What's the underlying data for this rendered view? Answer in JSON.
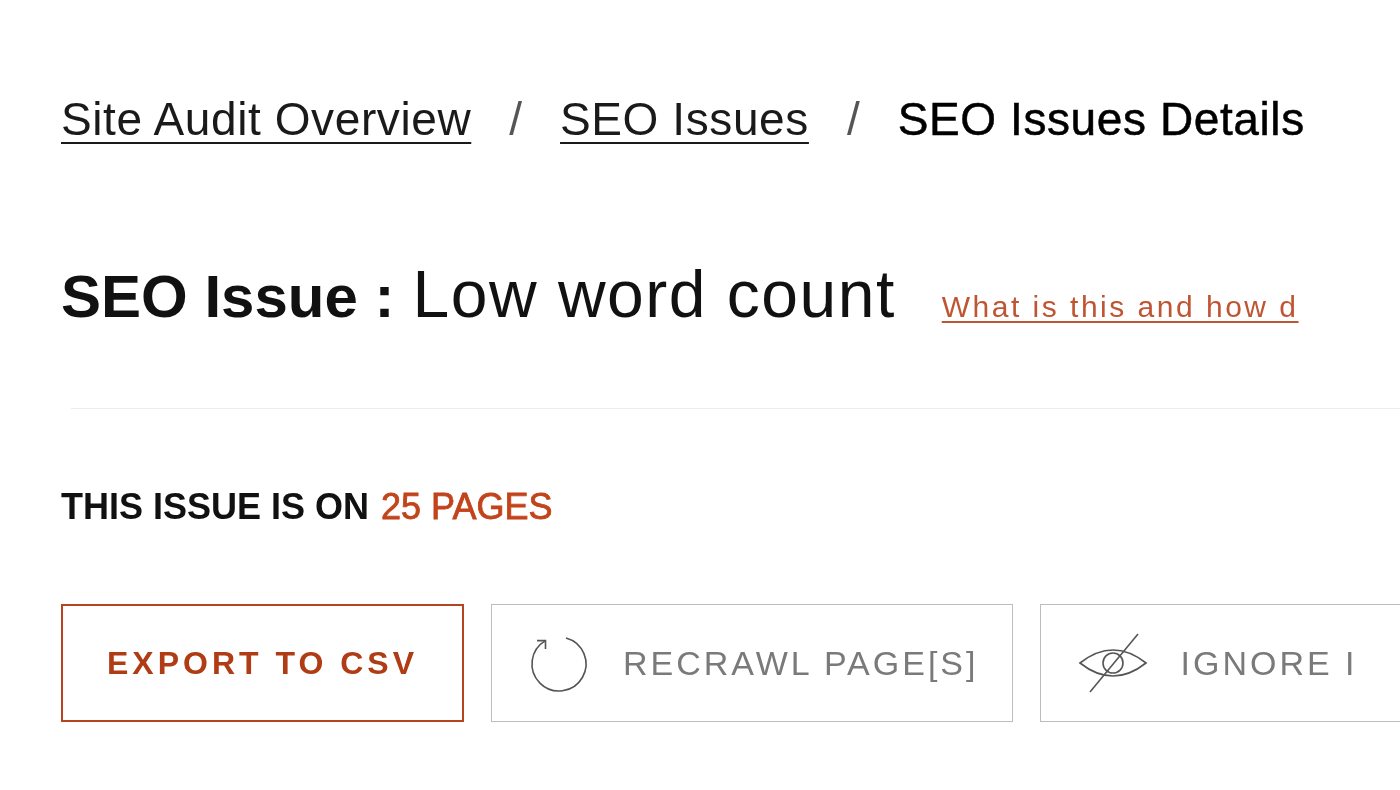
{
  "breadcrumbs": [
    {
      "label": "Site Audit Overview",
      "current": false
    },
    {
      "separator": "/",
      "label": "SEO Issues",
      "current": false
    },
    {
      "separator": "/",
      "label": "SEO Issues Details",
      "current": true
    }
  ],
  "issue": {
    "label": "SEO Issue :",
    "name": "Low word count",
    "help_link": "What is this and how d"
  },
  "summary": {
    "label": "THIS ISSUE IS ON",
    "count": "25 PAGES"
  },
  "actions": [
    {
      "label": "EXPORT TO CSV",
      "disabled": false
    },
    {
      "label": "RECRAWL PAGE[S]",
      "disabled": true
    },
    {
      "label": "IGNORE I",
      "disabled": true
    }
  ]
}
